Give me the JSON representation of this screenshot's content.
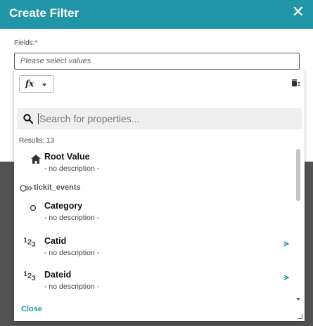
{
  "dialog": {
    "title": "Create Filter",
    "close_glyph": "✕"
  },
  "fields": {
    "label": "Fields:*",
    "placeholder": "Please select values"
  },
  "function_button": {
    "glyph": "fx"
  },
  "search": {
    "placeholder": "Search for properties..."
  },
  "results": {
    "count_text": "Results: 13"
  },
  "items": {
    "root": {
      "name": "Root Value",
      "desc": "- no description -",
      "icon": "home-icon"
    },
    "group": {
      "label": "tickit_events",
      "icon": "relationship-icon"
    },
    "category": {
      "name": "Category",
      "desc": "- no description -",
      "icon": "string-circle-icon"
    },
    "catid": {
      "name": "Catid",
      "desc": "- no description -",
      "icon": "numeric-icon"
    },
    "dateid": {
      "name": "Dateid",
      "desc": "- no description -",
      "icon": "numeric-icon"
    }
  },
  "footer": {
    "close_label": "Close"
  },
  "colors": {
    "accent": "#2196a8",
    "overlay": "#525252"
  }
}
